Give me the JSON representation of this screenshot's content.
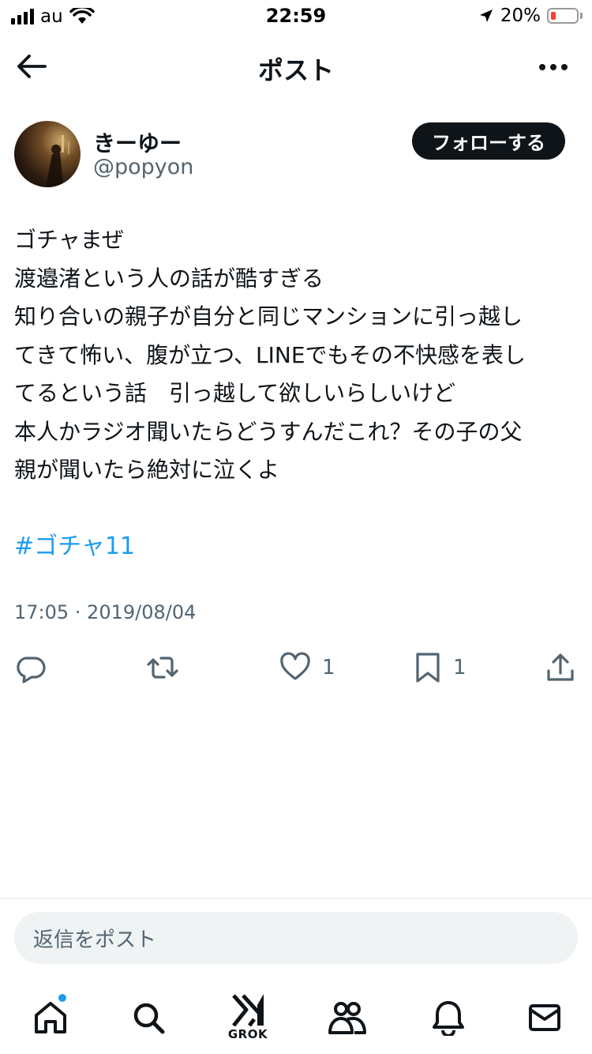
{
  "status_bar": {
    "carrier": "au",
    "time": "22:59",
    "battery_percent": "20%",
    "battery_level": 0.2
  },
  "header": {
    "title": "ポスト"
  },
  "author": {
    "display_name": "きーゆー",
    "handle": "@popyon",
    "follow_label": "フォローする"
  },
  "tweet": {
    "text": "ゴチャまぜ\n渡邉渚という人の話が酷すぎる\n知り合いの親子が自分と同じマンションに引っ越し\nてきて怖い、腹が立つ、LINEでもその不快感を表し\nてるという話　引っ越して欲しいらしいけど\n本人かラジオ聞いたらどうすんだこれ？その子の父\n親が聞いたら絶対に泣くよ",
    "hashtag": "#ゴチャ11",
    "timestamp": "17:05 · 2019/08/04"
  },
  "actions": {
    "reply_icon": "comment-icon",
    "retweet_icon": "retweet-icon",
    "like_icon": "heart-icon",
    "like_count": "1",
    "bookmark_icon": "bookmark-icon",
    "bookmark_count": "1",
    "share_icon": "share-icon"
  },
  "reply": {
    "placeholder": "返信をポスト"
  },
  "bottom_nav": {
    "items": [
      "home-icon",
      "search-icon",
      "grok-icon",
      "communities-icon",
      "notifications-icon",
      "messages-icon"
    ],
    "grok_label": "GROK"
  },
  "colors": {
    "accent": "#1d9bf0",
    "text": "#0f1419",
    "secondary": "#536471",
    "battery_low": "#ff3b30"
  }
}
